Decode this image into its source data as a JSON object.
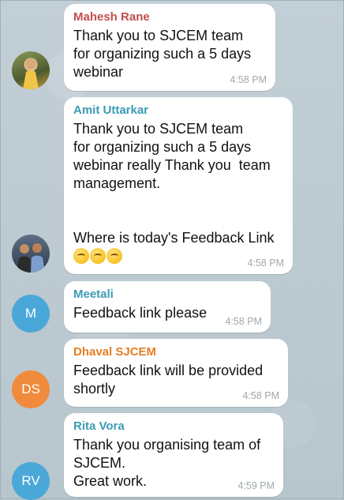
{
  "colors": {
    "chat_background": "#b9c7cf",
    "bubble": "#ffffff",
    "name_mahesh": "#c0504d",
    "name_amit": "#3a9bb5",
    "name_meetali": "#3a9bb5",
    "name_dhaval": "#e67e22",
    "name_rita": "#3a9bb5",
    "avatar_meetali": "#4aa8d8",
    "avatar_dhaval": "#f08a3c",
    "avatar_rita": "#4aa8d8"
  },
  "messages": [
    {
      "sender": "Mahesh Rane",
      "text": "Thank you to SJCEM team\nfor organizing such a 5 days\nwebinar",
      "time": "4:58 PM",
      "avatar": {
        "type": "photo",
        "icon": "person-photo-avatar"
      }
    },
    {
      "sender": "Amit Uttarkar",
      "text": "Thank you to SJCEM team\nfor organizing such a 5 days\nwebinar really Thank you  team\nmanagement.\n\n\nWhere is today's Feedback Link",
      "emoji": [
        "confused-face-emoji",
        "confused-face-emoji",
        "confused-face-emoji"
      ],
      "time": "4:58 PM",
      "avatar": {
        "type": "photo",
        "icon": "group-photo-avatar"
      }
    },
    {
      "sender": "Meetali",
      "text": "Feedback link please",
      "time": "4:58 PM",
      "avatar": {
        "type": "initials",
        "initials": "M"
      }
    },
    {
      "sender": "Dhaval SJCEM",
      "text": "Feedback link will be provided\nshortly",
      "time": "4:58 PM",
      "avatar": {
        "type": "initials",
        "initials": "DS"
      }
    },
    {
      "sender": "Rita Vora",
      "text": "Thank you organising team of\nSJCEM.\nGreat work.",
      "time": "4:59 PM",
      "avatar": {
        "type": "initials",
        "initials": "RV"
      }
    }
  ]
}
